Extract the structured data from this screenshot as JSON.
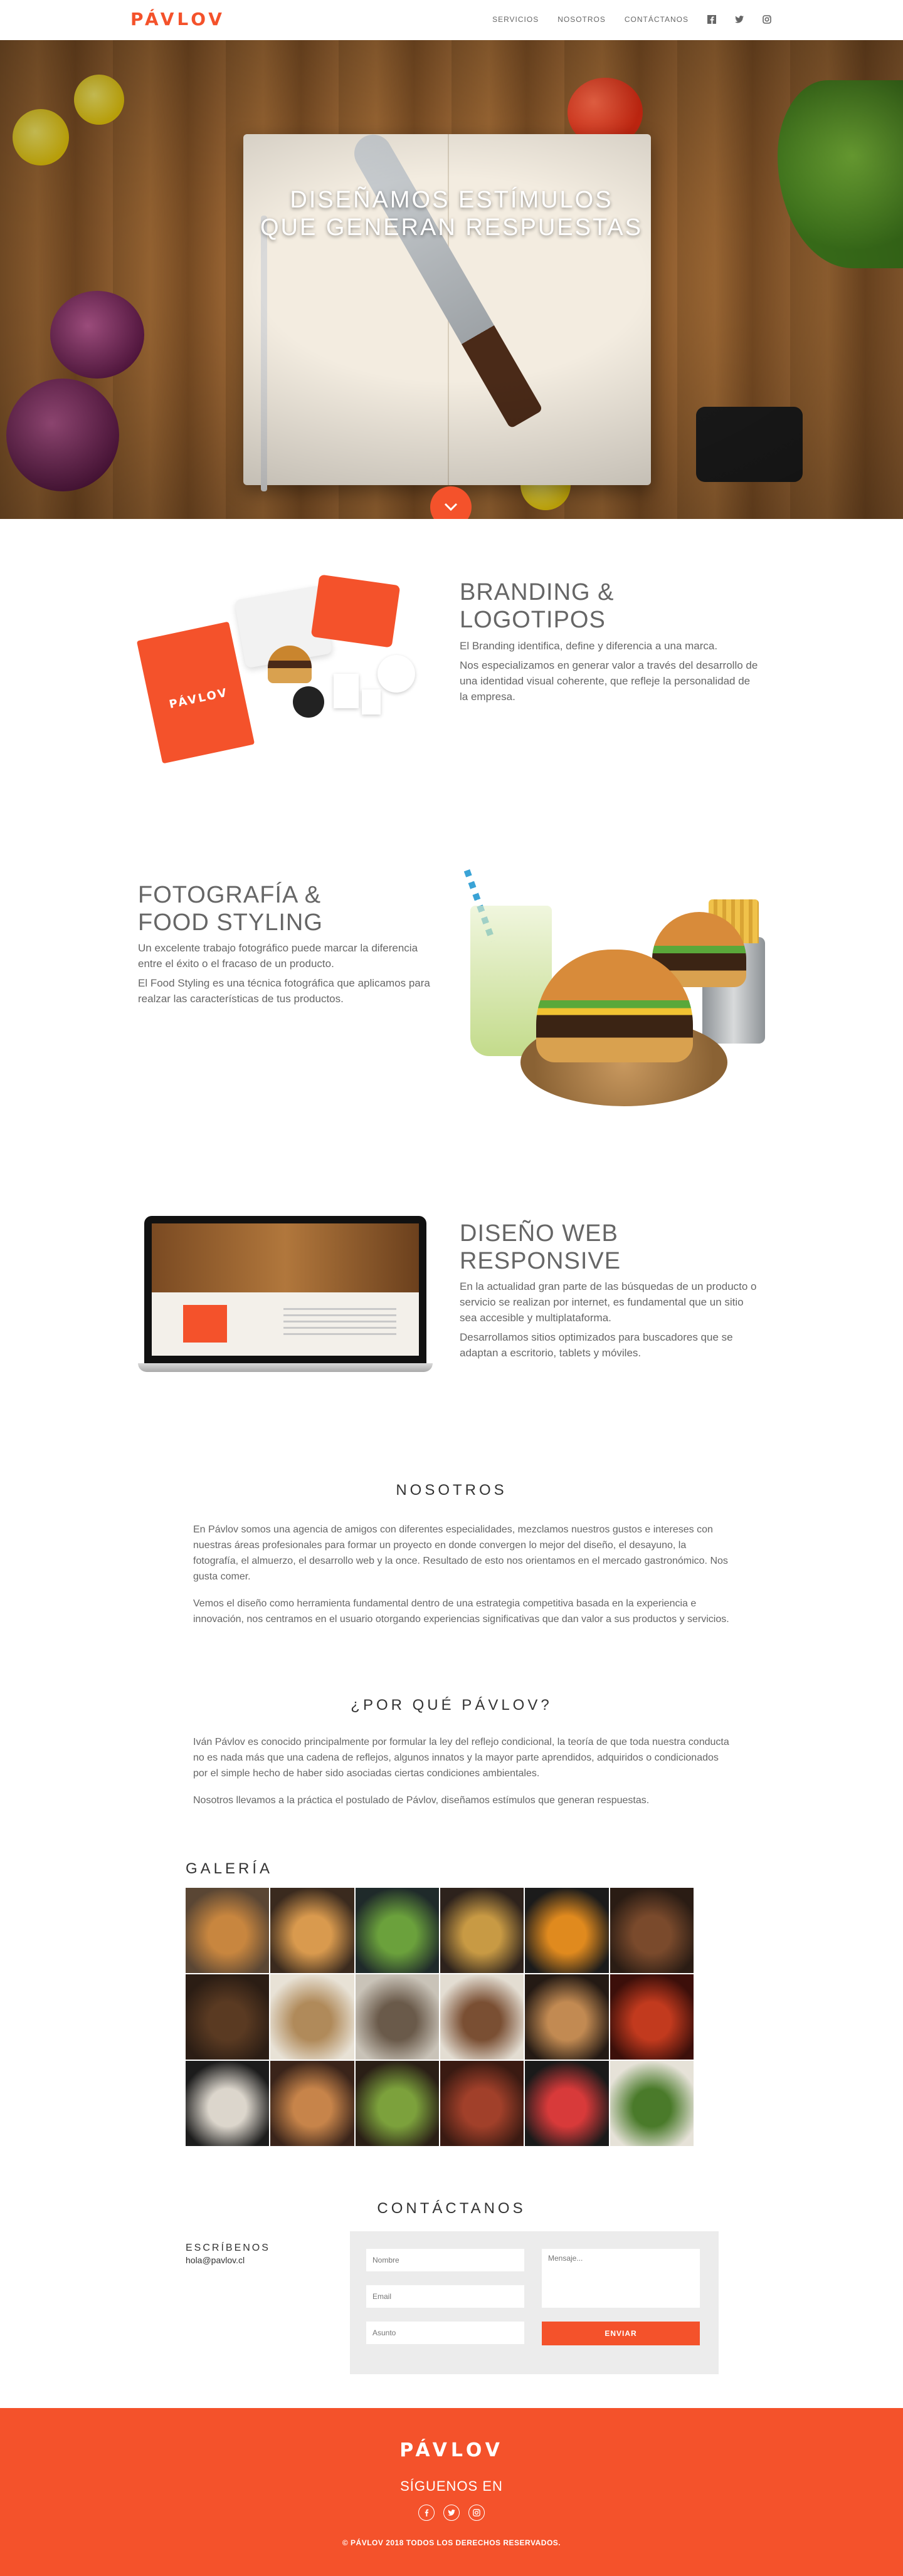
{
  "brand": {
    "logo": "PÁVLOV",
    "accent_color": "#f4522b"
  },
  "nav": {
    "links": [
      "SERVICIOS",
      "NOSOTROS",
      "CONTÁCTANOS"
    ],
    "social_icons": [
      "facebook-icon",
      "twitter-icon",
      "instagram-icon"
    ]
  },
  "hero": {
    "title_line1": "DISEÑAMOS ESTÍMULOS",
    "title_line2": "QUE GENERAN RESPUESTAS",
    "scroll_icon": "chevron-down-icon"
  },
  "services": [
    {
      "title_line1": "BRANDING &",
      "title_line2": "LOGOTIPOS",
      "paragraphs": [
        "El Branding identifica, define y diferencia a una marca.",
        "Nos especializamos en generar valor a través del desarrollo de una identidad visual coherente, que refleje la personalidad de la empresa."
      ],
      "mockup_logo": "PÁVLOV"
    },
    {
      "title_line1": "FOTOGRAFÍA &",
      "title_line2": "FOOD STYLING",
      "paragraphs": [
        "Un excelente trabajo fotográfico puede marcar la diferencia entre el éxito o el fracaso de un producto.",
        "El Food Styling es una técnica fotográfica que aplicamos para realzar las características de tus productos."
      ]
    },
    {
      "title_line1": "DISEÑO WEB",
      "title_line2": "RESPONSIVE",
      "paragraphs": [
        "En la actualidad gran parte de las búsquedas de un producto o servicio se realizan por internet, es fundamental que un sitio sea accesible y multiplataforma.",
        "Desarrollamos sitios optimizados para buscadores que se adaptan a escritorio, tablets y móviles."
      ]
    }
  ],
  "about": {
    "heading": "NOSOTROS",
    "paragraphs": [
      "En Pávlov somos una agencia de amigos con diferentes especialidades, mezclamos nuestros gustos e intereses con nuestras áreas profesionales para formar un proyecto en donde convergen lo mejor del diseño, el desayuno, la fotografía, el almuerzo, el desarrollo web y la once. Resultado de esto nos orientamos en el mercado gastronómico. Nos gusta comer.",
      "Vemos el diseño como herramienta fundamental dentro de una estrategia competitiva basada en la experiencia e innovación, nos centramos en el usuario otorgando experiencias significativas que dan valor a sus productos y servicios."
    ]
  },
  "why": {
    "heading": "¿POR QUÉ PÁVLOV?",
    "paragraphs": [
      "Iván Pávlov es conocido principalmente por formular la ley del reflejo condicional, la teoría de que toda nuestra conducta no es nada más que una cadena de reflejos, algunos innatos y la mayor parte aprendidos, adquiridos o condicionados por el simple hecho de haber sido asociadas ciertas condiciones ambientales.",
      "Nosotros llevamos a la práctica el postulado de Pávlov, diseñamos estímulos que generan respuestas."
    ]
  },
  "gallery": {
    "heading": "GALERÍA",
    "tile_colors": [
      [
        "#5a4634",
        "#c8863f"
      ],
      [
        "#3a2a1e",
        "#d99a4e"
      ],
      [
        "#1f2a2a",
        "#6ba13c"
      ],
      [
        "#2d221c",
        "#c89a44"
      ],
      [
        "#1b1b1b",
        "#e08a1e"
      ],
      [
        "#2a1c14",
        "#7a4a2c"
      ],
      [
        "#2b1d14",
        "#5a3a22"
      ],
      [
        "#e8e2d6",
        "#b08a5a"
      ],
      [
        "#c9c3b8",
        "#6a5a4a"
      ],
      [
        "#e3ddd2",
        "#7a4f33"
      ],
      [
        "#241a14",
        "#c28a52"
      ],
      [
        "#3c0f0a",
        "#c23a1e"
      ],
      [
        "#1c1c1c",
        "#dcd6cc"
      ],
      [
        "#3a241a",
        "#c7844a"
      ],
      [
        "#2a1f16",
        "#7ca13c"
      ],
      [
        "#3a1a12",
        "#a1402a"
      ],
      [
        "#1a1a1a",
        "#d83a3a"
      ],
      [
        "#e6e2d8",
        "#4a7a2a"
      ]
    ]
  },
  "contact": {
    "heading": "CONTÁCTANOS",
    "label": "ESCRÍBENOS",
    "email": "hola@pavlov.cl",
    "form": {
      "name_placeholder": "Nombre",
      "email_placeholder": "Email",
      "subject_placeholder": "Asunto",
      "message_placeholder": "Mensaje...",
      "send_label": "ENVIAR"
    }
  },
  "footer": {
    "logo": "PÁVLOV",
    "follow": "SÍGUENOS EN",
    "social_icons": [
      "facebook-icon",
      "twitter-icon",
      "instagram-icon"
    ],
    "copyright": "© PÁVLOV 2018 TODOS LOS DERECHOS RESERVADOS."
  }
}
